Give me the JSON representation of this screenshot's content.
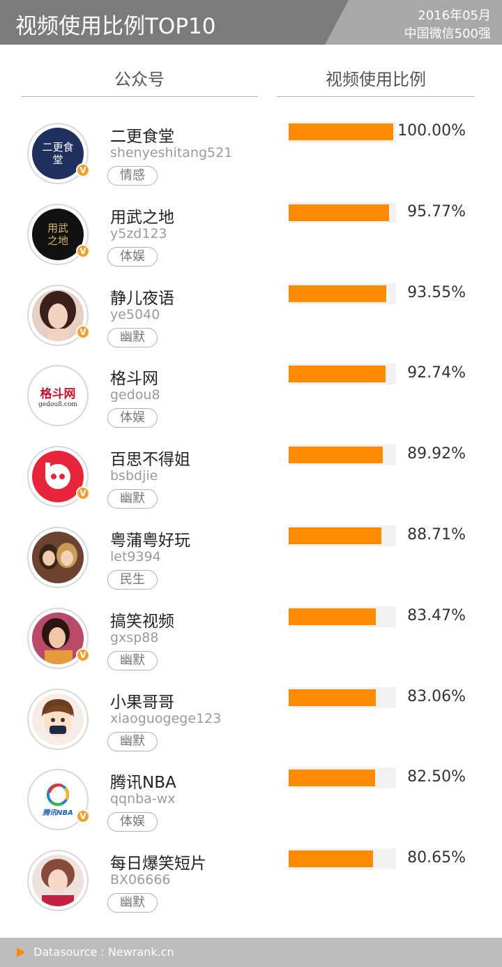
{
  "header": {
    "title": "视频使用比例TOP10",
    "date": "2016年05月",
    "subtitle": "中国微信500强"
  },
  "columns": {
    "account": "公众号",
    "ratio": "视频使用比例"
  },
  "footer": {
    "source": "Datasource : Newrank.cn"
  },
  "colors": {
    "bar": "#ff8c00",
    "header": "#7b7b7b",
    "badge": "#f0a030"
  },
  "chart_data": {
    "type": "bar",
    "title": "视频使用比例TOP10",
    "orientation": "horizontal",
    "xlim": [
      0,
      100
    ],
    "categories": [
      "二更食堂",
      "用武之地",
      "静儿夜语",
      "格斗网",
      "百思不得姐",
      "粤蒲粤好玩",
      "搞笑视频",
      "小果哥哥",
      "腾讯NBA",
      "每日爆笑短片"
    ],
    "values": [
      100.0,
      95.77,
      93.55,
      92.74,
      89.92,
      88.71,
      83.47,
      83.06,
      82.5,
      80.65
    ],
    "value_labels": [
      "100.00%",
      "95.77%",
      "93.55%",
      "92.74%",
      "89.92%",
      "88.71%",
      "83.47%",
      "83.06%",
      "82.50%",
      "80.65%"
    ]
  },
  "rows": [
    {
      "name": "二更食堂",
      "account": "shenyeshitang521",
      "tag": "情感",
      "verified": true,
      "avatar": "ergeng-logo",
      "avatar_text": "二更食堂"
    },
    {
      "name": "用武之地",
      "account": "y5zd123",
      "tag": "体娱",
      "verified": true,
      "avatar": "yongwu-logo",
      "avatar_text": "用武之地"
    },
    {
      "name": "静儿夜语",
      "account": "ye5040",
      "tag": "幽默",
      "verified": true,
      "avatar": "woman-photo"
    },
    {
      "name": "格斗网",
      "account": "gedou8",
      "tag": "体娱",
      "verified": false,
      "avatar": "gedou-logo",
      "avatar_text": "格斗网",
      "avatar_text2": "gedou8.com"
    },
    {
      "name": "百思不得姐",
      "account": "bsbdjie",
      "tag": "幽默",
      "verified": true,
      "avatar": "baisi-logo"
    },
    {
      "name": "粤蒲粤好玩",
      "account": "let9394",
      "tag": "民生",
      "verified": false,
      "avatar": "two-women-photo"
    },
    {
      "name": "搞笑视频",
      "account": "gxsp88",
      "tag": "幽默",
      "verified": true,
      "avatar": "woman-photo-2"
    },
    {
      "name": "小果哥哥",
      "account": "xiaoguogege123",
      "tag": "幽默",
      "verified": false,
      "avatar": "cartoon-boy"
    },
    {
      "name": "腾讯NBA",
      "account": "qqnba-wx",
      "tag": "体娱",
      "verified": true,
      "avatar": "tencent-nba-logo",
      "avatar_text": "腾讯NBA"
    },
    {
      "name": "每日爆笑短片",
      "account": "BX06666",
      "tag": "幽默",
      "verified": false,
      "avatar": "woman-photo-3"
    }
  ]
}
